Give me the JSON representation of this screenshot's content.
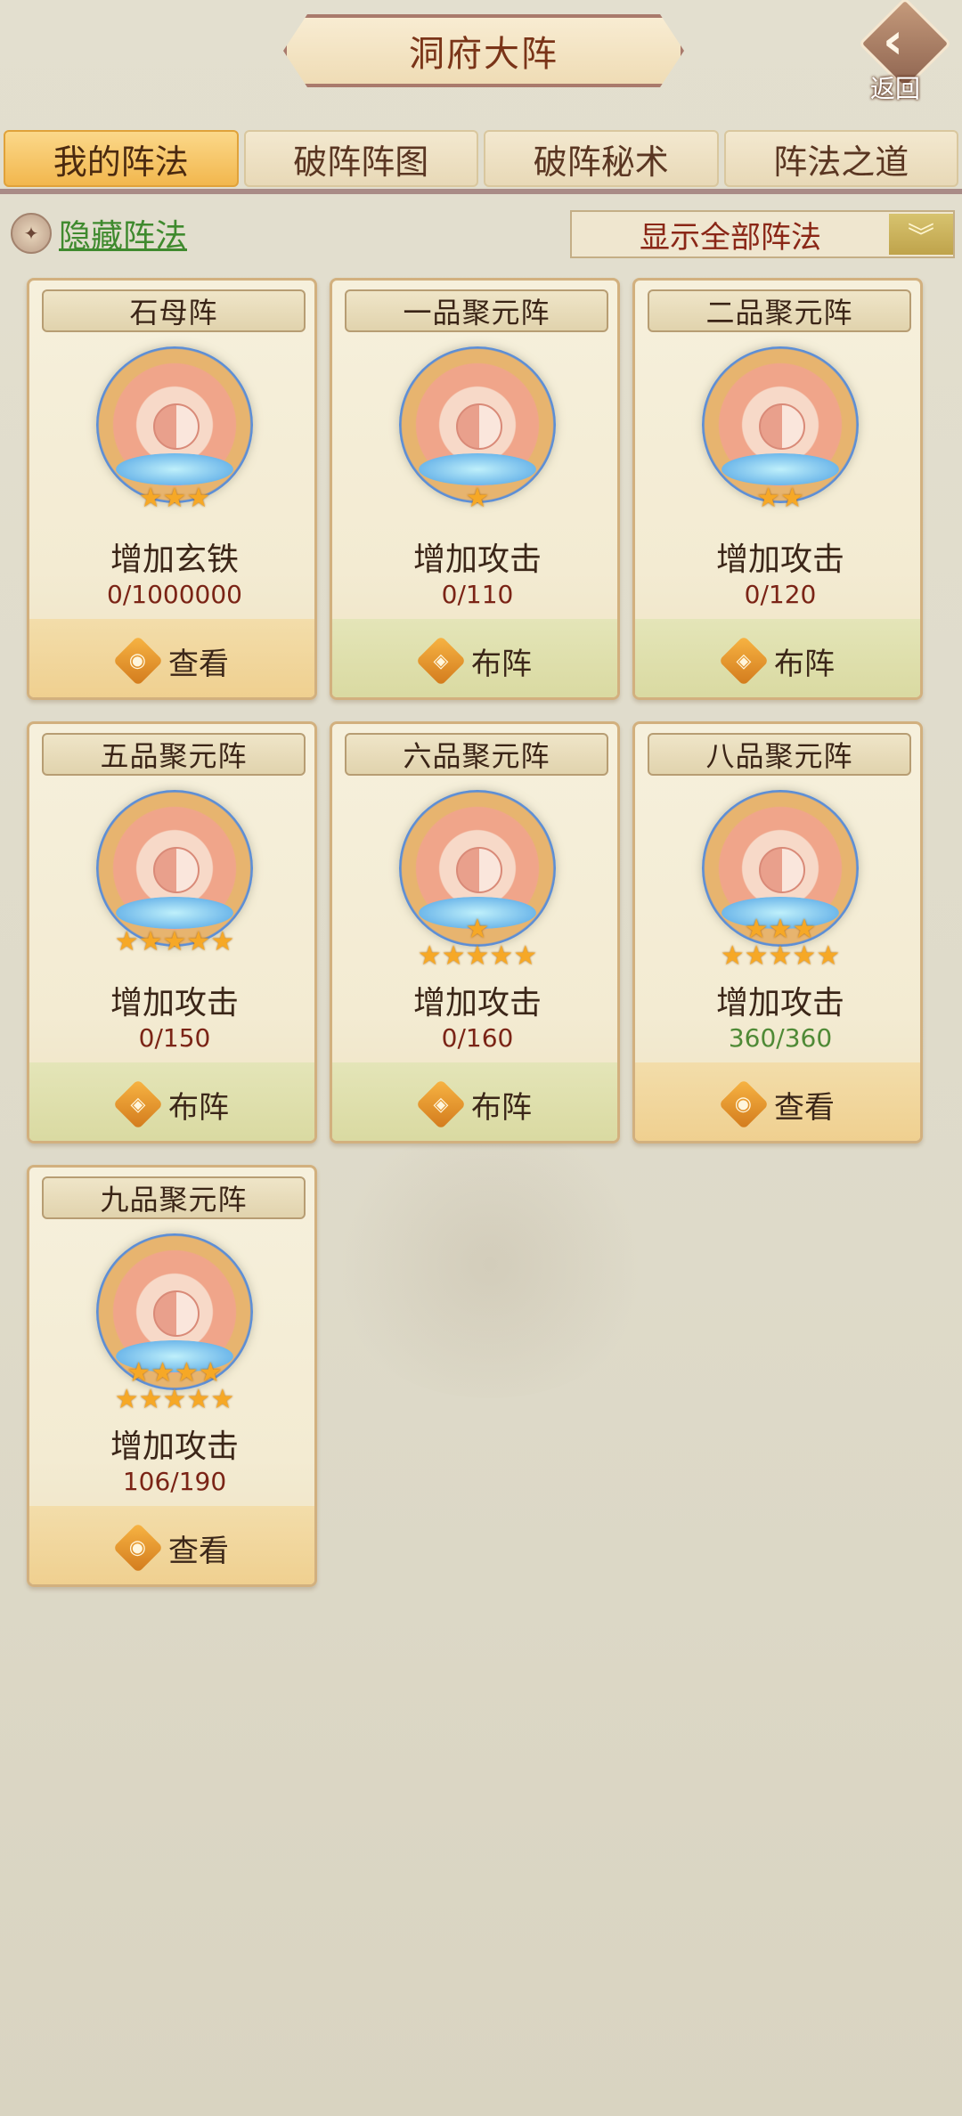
{
  "header": {
    "title": "洞府大阵",
    "back_label": "返回"
  },
  "tabs": [
    {
      "label": "我的阵法",
      "active": true
    },
    {
      "label": "破阵阵图",
      "active": false
    },
    {
      "label": "破阵秘术",
      "active": false
    },
    {
      "label": "阵法之道",
      "active": false
    }
  ],
  "filter": {
    "hide_label": "隐藏阵法",
    "select_value": "显示全部阵法"
  },
  "cards": [
    {
      "name": "石母阵",
      "stars": 3,
      "effect": "增加玄铁",
      "progress": "0/1000000",
      "action": "查看",
      "action_type": "view"
    },
    {
      "name": "一品聚元阵",
      "stars": 1,
      "effect": "增加攻击",
      "progress": "0/110",
      "action": "布阵",
      "action_type": "deploy"
    },
    {
      "name": "二品聚元阵",
      "stars": 2,
      "effect": "增加攻击",
      "progress": "0/120",
      "action": "布阵",
      "action_type": "deploy"
    },
    {
      "name": "五品聚元阵",
      "stars": 5,
      "effect": "增加攻击",
      "progress": "0/150",
      "action": "布阵",
      "action_type": "deploy"
    },
    {
      "name": "六品聚元阵",
      "stars": 6,
      "effect": "增加攻击",
      "progress": "0/160",
      "action": "布阵",
      "action_type": "deploy"
    },
    {
      "name": "八品聚元阵",
      "stars": 8,
      "effect": "增加攻击",
      "progress": "360/360",
      "action": "查看",
      "action_type": "view"
    },
    {
      "name": "九品聚元阵",
      "stars": 9,
      "effect": "增加攻击",
      "progress": "106/190",
      "action": "查看",
      "action_type": "view"
    }
  ],
  "colors": {
    "accent": "#f2b74e",
    "progress_done": "#4f8a36",
    "progress": "#7b2416"
  }
}
